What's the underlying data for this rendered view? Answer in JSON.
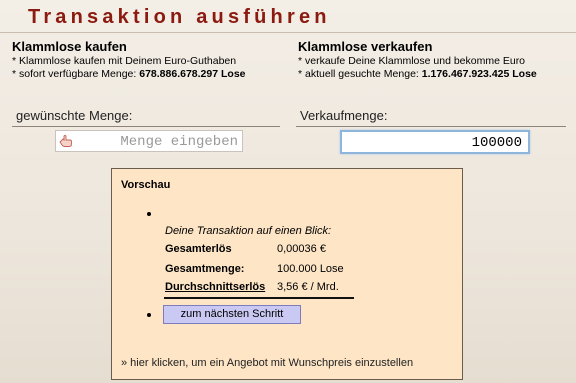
{
  "page": {
    "title": "Transaktion ausführen"
  },
  "buy": {
    "heading": "Klammlose kaufen",
    "line1": "* Klammlose kaufen mit Deinem Euro-Guthaben",
    "line2_prefix": "* sofort verfügbare Menge: ",
    "line2_value": "678.886.678.297 Lose"
  },
  "sell": {
    "heading": "Klammlose verkaufen",
    "line1": "* verkaufe Deine Klammlose und bekomme Euro",
    "line2_prefix": "* aktuell gesuchte Menge: ",
    "line2_value": "1.176.467.923.425 Lose"
  },
  "fields": {
    "buy_label": "gewünschte Menge:",
    "buy_placeholder": "Menge eingeben",
    "sell_label": "Verkaufmenge:",
    "sell_value": "100000"
  },
  "preview": {
    "title": "Vorschau",
    "caption": "Deine Transaktion auf einen Blick:",
    "rows": [
      {
        "key": "Gesamterlös",
        "value": "0,00036 €"
      },
      {
        "key": "Gesamtmenge:",
        "value": "100.000 Lose"
      },
      {
        "key": "Durchschnittserlös",
        "value": "3,56 € / Mrd."
      }
    ],
    "next_button": "zum nächsten Schritt",
    "offer_link": "» hier klicken, um ein Angebot mit Wunschpreis einzustellen"
  },
  "icons": {
    "input_hint": "pointing-hand-icon"
  },
  "colors": {
    "title": "#8b1a10",
    "preview_bg": "#fde5c6",
    "button_bg": "#c9c9f3",
    "focus_border": "#8fb5dc"
  }
}
